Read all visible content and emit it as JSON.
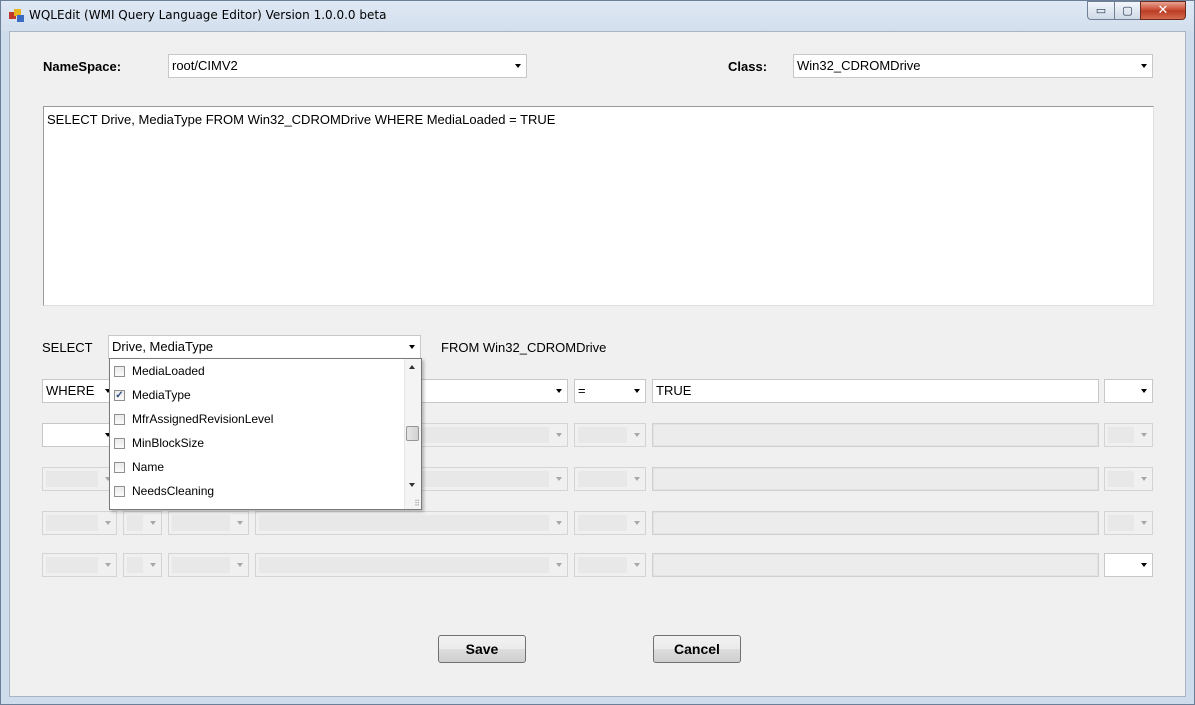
{
  "window": {
    "title": "WQLEdit (WMI Query Language Editor)  Version 1.0.0.0 beta",
    "controls": {
      "minimize": "▭",
      "maximize": "▢",
      "close": "✕"
    }
  },
  "namespace": {
    "label": "NameSpace:",
    "value": "root/CIMV2"
  },
  "class": {
    "label": "Class:",
    "value": "Win32_CDROMDrive"
  },
  "query_text": "SELECT Drive, MediaType FROM Win32_CDROMDrive WHERE MediaLoaded = TRUE",
  "select_row": {
    "label": "SELECT",
    "value": "Drive, MediaType",
    "from_text": "FROM Win32_CDROMDrive"
  },
  "dropdown": {
    "items": [
      {
        "label": "MediaLoaded",
        "checked": false,
        "mark": ""
      },
      {
        "label": "MediaType",
        "checked": true,
        "mark": "✓"
      },
      {
        "label": "MfrAssignedRevisionLevel",
        "checked": false,
        "mark": ""
      },
      {
        "label": "MinBlockSize",
        "checked": false,
        "mark": ""
      },
      {
        "label": "Name",
        "checked": false,
        "mark": ""
      },
      {
        "label": "NeedsCleaning",
        "checked": false,
        "mark": ""
      }
    ]
  },
  "where_row": {
    "keyword": "WHERE",
    "operator": "=",
    "value": "TRUE"
  },
  "buttons": {
    "save": "Save",
    "cancel": "Cancel"
  },
  "colors": {
    "title_gradient": "#d3dfee",
    "close_button": "#c7452c",
    "client_bg": "#f0f0f0"
  }
}
